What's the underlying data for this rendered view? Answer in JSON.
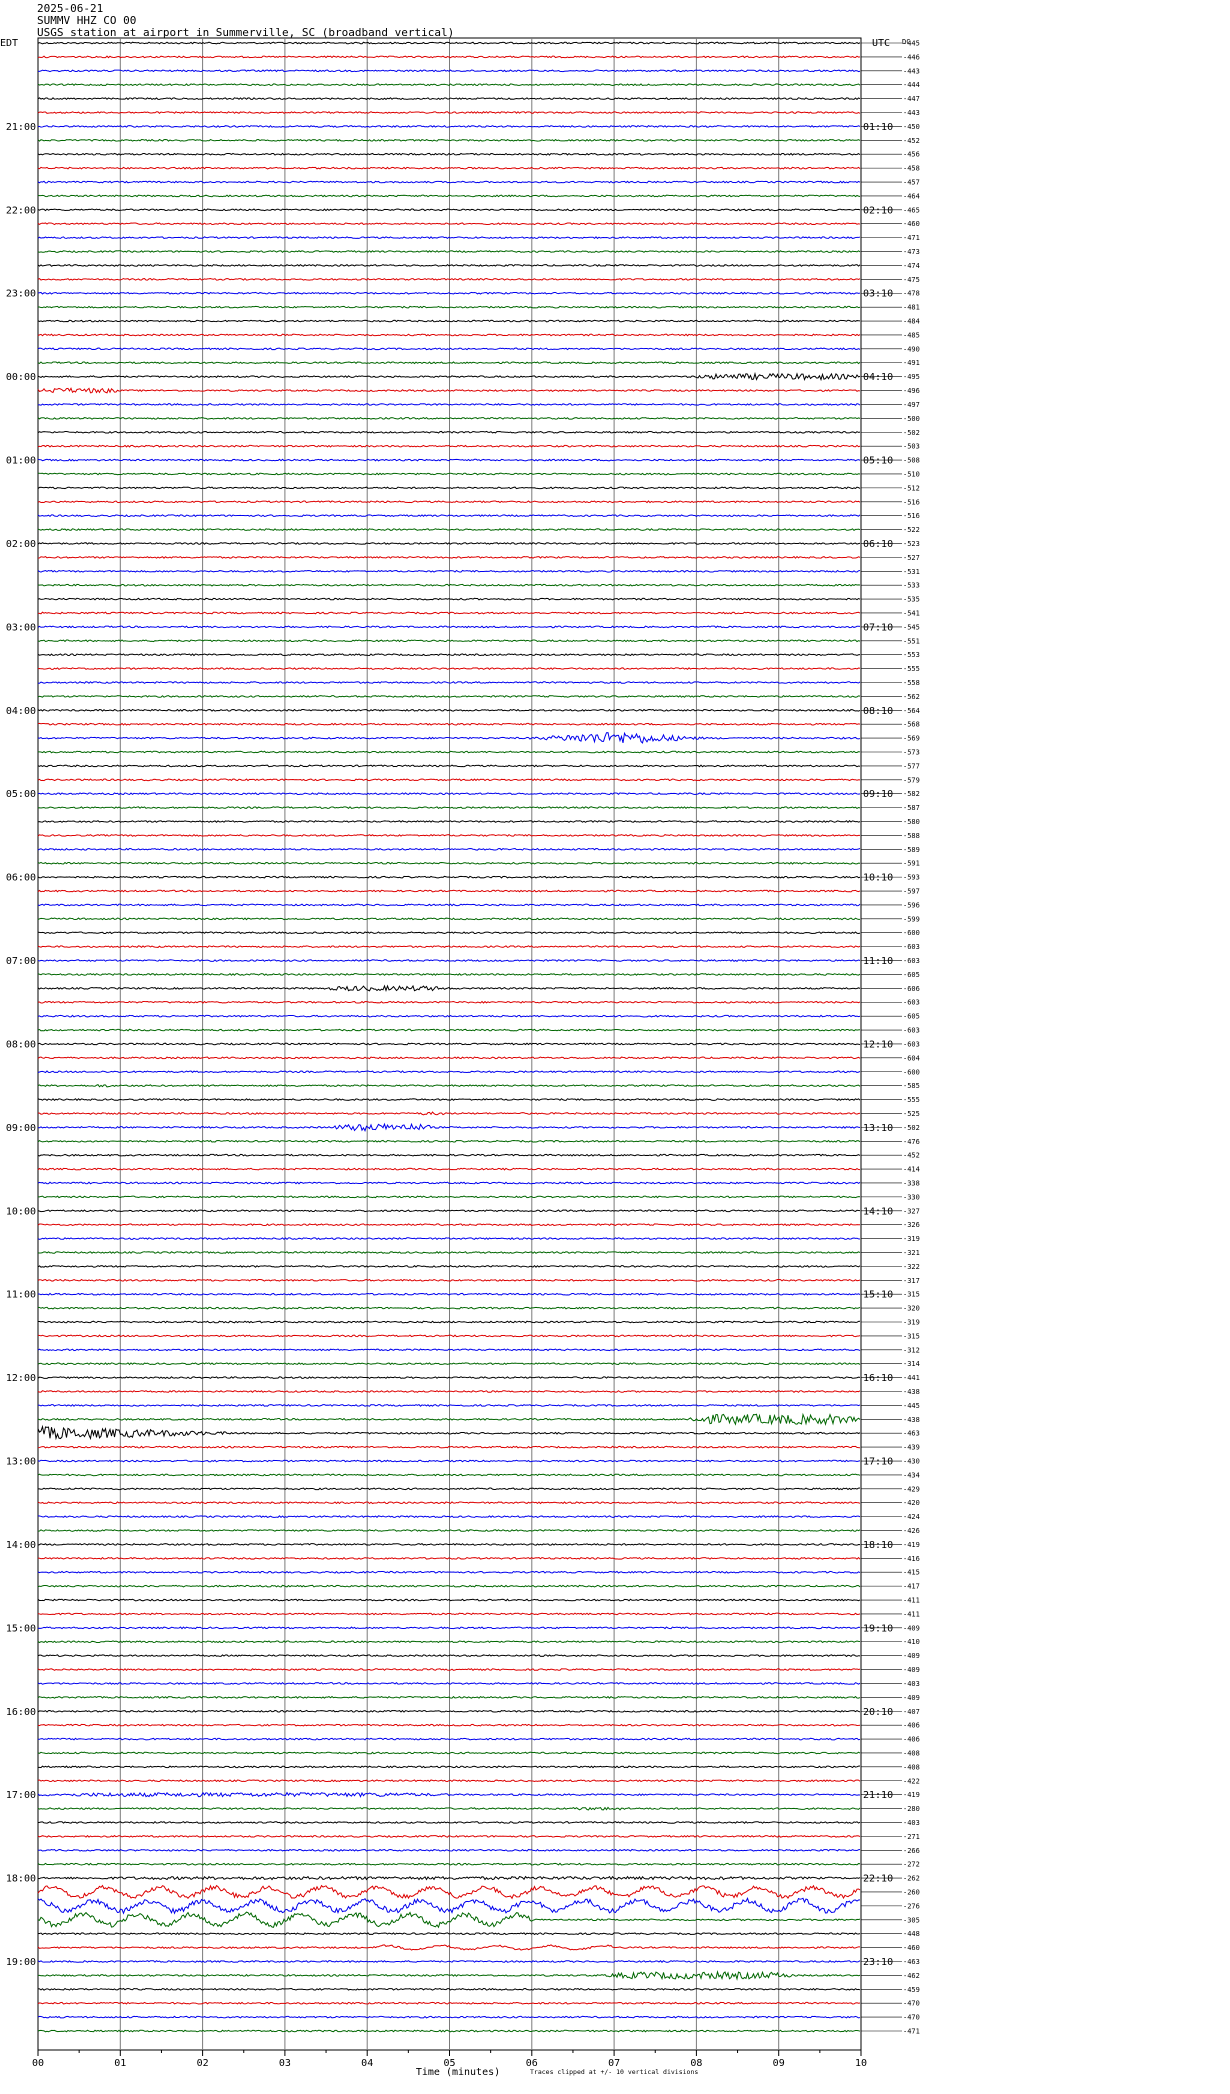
{
  "header": {
    "date": "2025-06-21",
    "station_line": "SUMMV HHZ CO 00",
    "description": "USGS station at airport in Summerville, SC (broadband vertical)"
  },
  "chart_data": {
    "type": "line",
    "xlabel": "Time (minutes)",
    "xlim": [
      0,
      10
    ],
    "x_tick_labels": [
      "00",
      "01",
      "02",
      "03",
      "04",
      "05",
      "06",
      "07",
      "08",
      "09",
      "10"
    ],
    "left_timezone": "EDT",
    "right_timezone": "UTC",
    "right_header": "DC",
    "footnote": "Traces clipped at +/- 10 vertical divisions",
    "trace_colors": [
      "#000000",
      "#dd0000",
      "#0000ee",
      "#006600"
    ],
    "left_hour_labels": [
      "21:00",
      "22:00",
      "23:00",
      "00:00",
      "01:00",
      "02:00",
      "03:00",
      "04:00",
      "05:00",
      "06:00",
      "07:00",
      "08:00",
      "09:00",
      "10:00",
      "11:00",
      "12:00",
      "13:00",
      "14:00",
      "15:00",
      "16:00",
      "17:00",
      "18:00",
      "19:00"
    ],
    "right_hour_labels": [
      "01:10",
      "02:10",
      "03:10",
      "04:10",
      "05:10",
      "06:10",
      "07:10",
      "08:10",
      "09:10",
      "10:10",
      "11:10",
      "12:10",
      "13:10",
      "14:10",
      "15:10",
      "16:10",
      "17:10",
      "18:10",
      "19:10",
      "20:10",
      "21:10",
      "22:10",
      "23:10"
    ],
    "first_hour_row": 6,
    "rows_per_hour": 6,
    "row_offsets": [
      "-445",
      "-446",
      "-443",
      "-444",
      "-447",
      "-443",
      "-450",
      "-452",
      "-456",
      "-458",
      "-457",
      "-464",
      "-465",
      "-460",
      "-471",
      "-473",
      "-474",
      "-475",
      "-478",
      "-481",
      "-484",
      "-485",
      "-490",
      "-491",
      "-495",
      "-496",
      "-497",
      "-500",
      "-502",
      "-503",
      "-508",
      "-510",
      "-512",
      "-516",
      "-516",
      "-522",
      "-523",
      "-527",
      "-531",
      "-533",
      "-535",
      "-541",
      "-545",
      "-551",
      "-553",
      "-555",
      "-558",
      "-562",
      "-564",
      "-568",
      "-569",
      "-573",
      "-577",
      "-579",
      "-582",
      "-587",
      "-580",
      "-588",
      "-589",
      "-591",
      "-593",
      "-597",
      "-596",
      "-599",
      "-600",
      "-603",
      "-603",
      "-605",
      "-606",
      "-603",
      "-605",
      "-603",
      "-603",
      "-604",
      "-600",
      "-585",
      "-555",
      "-525",
      "-502",
      "-476",
      "-452",
      "-414",
      "-338",
      "-330",
      "-327",
      "-326",
      "-319",
      "-321",
      "-322",
      "-317",
      "-315",
      "-320",
      "-319",
      "-315",
      "-312",
      "-314",
      "-441",
      "-438",
      "-445",
      "-438",
      "-463",
      "-439",
      "-430",
      "-434",
      "-429",
      "-420",
      "-424",
      "-426",
      "-419",
      "-416",
      "-415",
      "-417",
      "-411",
      "-411",
      "-409",
      "-410",
      "-409",
      "-409",
      "-403",
      "-409",
      "-407",
      "-406",
      "-406",
      "-408",
      "-408",
      "-422",
      "-419",
      "-280",
      "-403",
      "-271",
      "-266",
      "-272",
      "-262",
      "-260",
      "-276",
      "-305",
      "-448",
      "-460",
      "-463",
      "-462",
      "-459",
      "-470",
      "-470",
      "-471"
    ],
    "events": [
      {
        "row": 24,
        "start_min": 8.0,
        "end_min": 10.0,
        "amplitude": 3.0,
        "kind": "noise"
      },
      {
        "row": 25,
        "start_min": 0.0,
        "end_min": 1.0,
        "amplitude": 2.5,
        "kind": "noise"
      },
      {
        "row": 50,
        "start_min": 5.6,
        "end_min": 9.2,
        "amplitude": 6.0,
        "kind": "quake"
      },
      {
        "row": 68,
        "start_min": 3.5,
        "end_min": 5.0,
        "amplitude": 2.5,
        "kind": "noise"
      },
      {
        "row": 78,
        "start_min": 3.6,
        "end_min": 4.8,
        "amplitude": 3.5,
        "kind": "noise"
      },
      {
        "row": 77,
        "start_min": 4.6,
        "end_min": 5.0,
        "amplitude": 1.5,
        "kind": "noise"
      },
      {
        "row": 75,
        "start_min": 0.7,
        "end_min": 0.9,
        "amplitude": 1.5,
        "kind": "noise"
      },
      {
        "row": 99,
        "start_min": 7.9,
        "end_min": 10.0,
        "amplitude": 5.0,
        "kind": "noise"
      },
      {
        "row": 100,
        "start_min": 0.0,
        "end_min": 2.5,
        "amplitude": 6.0,
        "kind": "decay"
      },
      {
        "row": 126,
        "start_min": 0.0,
        "end_min": 5.0,
        "amplitude": 2.0,
        "kind": "noise"
      },
      {
        "row": 127,
        "start_min": 6.4,
        "end_min": 7.2,
        "amplitude": 1.5,
        "kind": "noise"
      },
      {
        "row": 132,
        "start_min": 0.0,
        "end_min": 10.0,
        "amplitude": 1.5,
        "kind": "noise"
      },
      {
        "row": 133,
        "start_min": 0.0,
        "end_min": 10.0,
        "amplitude": 6.0,
        "kind": "wave"
      },
      {
        "row": 134,
        "start_min": 0.0,
        "end_min": 10.0,
        "amplitude": 7.0,
        "kind": "wave"
      },
      {
        "row": 135,
        "start_min": 0.0,
        "end_min": 6.0,
        "amplitude": 7.0,
        "kind": "wave"
      },
      {
        "row": 137,
        "start_min": 4.0,
        "end_min": 7.0,
        "amplitude": 2.5,
        "kind": "wave"
      },
      {
        "row": 139,
        "start_min": 6.9,
        "end_min": 9.2,
        "amplitude": 3.5,
        "kind": "noise"
      }
    ]
  }
}
